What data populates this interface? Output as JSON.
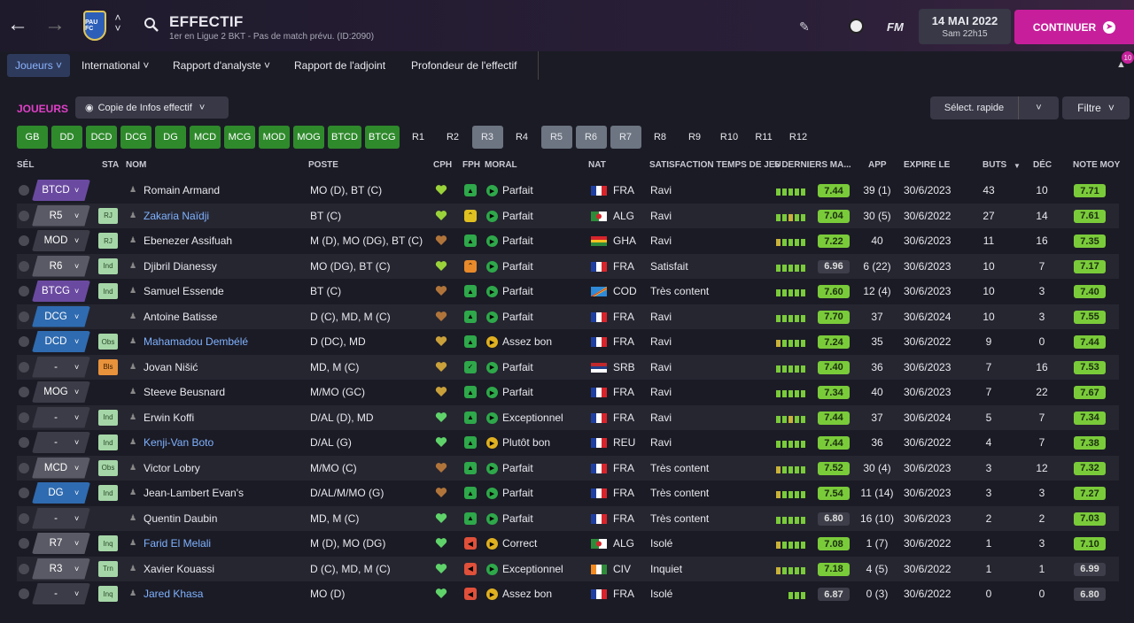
{
  "header": {
    "title": "EFFECTIF",
    "subtitle": "1er en Ligue 2 BKT - Pas de match prévu. (ID:2090)",
    "club_crest_text": "PAU FC",
    "logo_text": "FM",
    "date": "14 MAI 2022",
    "time": "Sam 22h15",
    "continue_label": "CONTINUER",
    "notifications": "10",
    "accent_color": "#c71f9b"
  },
  "menu": {
    "items": [
      {
        "label": "Joueurs",
        "active": true
      },
      {
        "label": "International",
        "active": false
      },
      {
        "label": "Rapport d'analyste",
        "active": false
      },
      {
        "label": "Rapport de l'adjoint",
        "active": false
      },
      {
        "label": "Profondeur de l'effectif",
        "active": false
      }
    ]
  },
  "toolbar": {
    "section_title": "JOUEURS",
    "copy_label": "Copie de Infos effectif",
    "quick_select_label": "Sélect. rapide",
    "filter_label": "Filtre"
  },
  "position_filters": [
    {
      "label": "GB",
      "style": "g"
    },
    {
      "label": "DD",
      "style": "g"
    },
    {
      "label": "DCD",
      "style": "g"
    },
    {
      "label": "DCG",
      "style": "g"
    },
    {
      "label": "DG",
      "style": "g"
    },
    {
      "label": "MCD",
      "style": "g"
    },
    {
      "label": "MCG",
      "style": "g"
    },
    {
      "label": "MOD",
      "style": "g"
    },
    {
      "label": "MOG",
      "style": "g"
    },
    {
      "label": "BTCD",
      "style": "g"
    },
    {
      "label": "BTCG",
      "style": "g"
    },
    {
      "label": "R1",
      "style": "k"
    },
    {
      "label": "R2",
      "style": "k"
    },
    {
      "label": "R3",
      "style": "s"
    },
    {
      "label": "R4",
      "style": "k"
    },
    {
      "label": "R5",
      "style": "s"
    },
    {
      "label": "R6",
      "style": "s"
    },
    {
      "label": "R7",
      "style": "s"
    },
    {
      "label": "R8",
      "style": "k"
    },
    {
      "label": "R9",
      "style": "k"
    },
    {
      "label": "R10",
      "style": "k"
    },
    {
      "label": "R11",
      "style": "k"
    },
    {
      "label": "R12",
      "style": "k"
    }
  ],
  "columns": {
    "sel": "SÉL",
    "sta": "STA",
    "nom": "NOM",
    "poste": "POSTE",
    "cph": "CPH",
    "fph": "FPH",
    "moral": "MORAL",
    "nat": "NAT",
    "satisfaction": "SATISFACTION TEMPS DE JEU",
    "derniers": "5 DERNIERS MA...",
    "app": "APP",
    "expire": "EXPIRE LE",
    "buts": "BUTS",
    "dec": "DÉC",
    "note": "NOTE MOY",
    "sort_icon": "▼"
  },
  "players": [
    {
      "sel": "BTCD",
      "sel_color": "#6a4aa0",
      "sta": "",
      "name": "Romain Armand",
      "link": false,
      "poste": "MO (D), BT (C)",
      "heart": "#9ad23a",
      "fph": "up",
      "moral": "Parfait",
      "mor": "#2ea84a",
      "flag": "fra",
      "nat": "FRA",
      "sat": "Ravi",
      "form": [
        "#7acb3a",
        "#7acb3a",
        "#7acb3a",
        "#7acb3a",
        "#7acb3a"
      ],
      "rating": "7.44",
      "app": "39 (1)",
      "expire": "30/6/2023",
      "buts": "43",
      "dec": "10",
      "note": "7.71"
    },
    {
      "sel": "R5",
      "sel_color": "#5a5a66",
      "sta": "RJ",
      "name": "Zakaria Naïdji",
      "link": true,
      "poste": "BT (C)",
      "heart": "#9ad23a",
      "fph": "yellow",
      "moral": "Parfait",
      "mor": "#2ea84a",
      "flag": "alg",
      "nat": "ALG",
      "sat": "Ravi",
      "form": [
        "#7acb3a",
        "#7acb3a",
        "#c9b23a",
        "#7acb3a",
        "#7acb3a"
      ],
      "rating": "7.04",
      "app": "30 (5)",
      "expire": "30/6/2022",
      "buts": "27",
      "dec": "14",
      "note": "7.61"
    },
    {
      "sel": "MOD",
      "sel_color": "#3c3c48",
      "sta": "RJ",
      "name": "Ebenezer Assifuah",
      "link": false,
      "poste": "M (D), MO (DG), BT (C)",
      "heart": "#b0743a",
      "fph": "up",
      "moral": "Parfait",
      "mor": "#2ea84a",
      "flag": "gha",
      "nat": "GHA",
      "sat": "Ravi",
      "form": [
        "#c9b23a",
        "#7acb3a",
        "#7acb3a",
        "#7acb3a",
        "#7acb3a"
      ],
      "rating": "7.22",
      "app": "40",
      "expire": "30/6/2023",
      "buts": "11",
      "dec": "16",
      "note": "7.35"
    },
    {
      "sel": "R6",
      "sel_color": "#5a5a66",
      "sta": "Ind",
      "name": "Djibril Dianessy",
      "link": false,
      "poste": "MO (DG), BT (C)",
      "heart": "#9ad23a",
      "fph": "orange",
      "moral": "Parfait",
      "mor": "#2ea84a",
      "flag": "fra",
      "nat": "FRA",
      "sat": "Satisfait",
      "form": [
        "#7acb3a",
        "#7acb3a",
        "#7acb3a",
        "#7acb3a",
        "#7acb3a"
      ],
      "rating": "6.96",
      "app": "6 (22)",
      "expire": "30/6/2023",
      "buts": "10",
      "dec": "7",
      "note": "7.17"
    },
    {
      "sel": "BTCG",
      "sel_color": "#6a4aa0",
      "sta": "Ind",
      "name": "Samuel Essende",
      "link": false,
      "poste": "BT (C)",
      "heart": "#b0743a",
      "fph": "up",
      "moral": "Parfait",
      "mor": "#2ea84a",
      "flag": "cod",
      "nat": "COD",
      "sat": "Très content",
      "form": [
        "#7acb3a",
        "#7acb3a",
        "#7acb3a",
        "#7acb3a",
        "#7acb3a"
      ],
      "rating": "7.60",
      "app": "12 (4)",
      "expire": "30/6/2023",
      "buts": "10",
      "dec": "3",
      "note": "7.40"
    },
    {
      "sel": "DCG",
      "sel_color": "#2f6bb0",
      "sta": "",
      "name": "Antoine Batisse",
      "link": false,
      "poste": "D (C), MD, M (C)",
      "heart": "#b0743a",
      "fph": "up",
      "moral": "Parfait",
      "mor": "#2ea84a",
      "flag": "fra",
      "nat": "FRA",
      "sat": "Ravi",
      "form": [
        "#7acb3a",
        "#7acb3a",
        "#7acb3a",
        "#7acb3a",
        "#7acb3a"
      ],
      "rating": "7.70",
      "app": "37",
      "expire": "30/6/2024",
      "buts": "10",
      "dec": "3",
      "note": "7.55"
    },
    {
      "sel": "DCD",
      "sel_color": "#2f6bb0",
      "sta": "Obs",
      "name": "Mahamadou Dembélé",
      "link": true,
      "poste": "D (DC), MD",
      "heart": "#c9a03a",
      "fph": "up",
      "moral": "Assez bon",
      "mor": "#e0b020",
      "flag": "fra",
      "nat": "FRA",
      "sat": "Ravi",
      "form": [
        "#c9b23a",
        "#7acb3a",
        "#7acb3a",
        "#7acb3a",
        "#7acb3a"
      ],
      "rating": "7.24",
      "app": "35",
      "expire": "30/6/2022",
      "buts": "9",
      "dec": "0",
      "note": "7.44"
    },
    {
      "sel": "-",
      "sel_color": "#3c3c48",
      "sta": "Bls",
      "name": "Jovan Nišić",
      "link": false,
      "poste": "MD, M (C)",
      "heart": "#c9a03a",
      "fph": "check",
      "moral": "Parfait",
      "mor": "#2ea84a",
      "flag": "srb",
      "nat": "SRB",
      "sat": "Ravi",
      "form": [
        "#7acb3a",
        "#7acb3a",
        "#7acb3a",
        "#7acb3a",
        "#7acb3a"
      ],
      "rating": "7.40",
      "app": "36",
      "expire": "30/6/2023",
      "buts": "7",
      "dec": "16",
      "note": "7.53"
    },
    {
      "sel": "MOG",
      "sel_color": "#3c3c48",
      "sta": "",
      "name": "Steeve Beusnard",
      "link": false,
      "poste": "M/MO (GC)",
      "heart": "#c9a03a",
      "fph": "up",
      "moral": "Parfait",
      "mor": "#2ea84a",
      "flag": "fra",
      "nat": "FRA",
      "sat": "Ravi",
      "form": [
        "#7acb3a",
        "#7acb3a",
        "#7acb3a",
        "#7acb3a",
        "#7acb3a"
      ],
      "rating": "7.34",
      "app": "40",
      "expire": "30/6/2023",
      "buts": "7",
      "dec": "22",
      "note": "7.67"
    },
    {
      "sel": "-",
      "sel_color": "#3c3c48",
      "sta": "Ind",
      "name": "Erwin Koffi",
      "link": false,
      "poste": "D/AL (D), MD",
      "heart": "#5fd36a",
      "fph": "up",
      "moral": "Exceptionnel",
      "mor": "#2ea84a",
      "flag": "fra",
      "nat": "FRA",
      "sat": "Ravi",
      "form": [
        "#7acb3a",
        "#7acb3a",
        "#c9b23a",
        "#7acb3a",
        "#7acb3a"
      ],
      "rating": "7.44",
      "app": "37",
      "expire": "30/6/2024",
      "buts": "5",
      "dec": "7",
      "note": "7.34"
    },
    {
      "sel": "-",
      "sel_color": "#3c3c48",
      "sta": "Ind",
      "name": "Kenji-Van Boto",
      "link": true,
      "poste": "D/AL (G)",
      "heart": "#5fd36a",
      "fph": "up",
      "moral": "Plutôt bon",
      "mor": "#e0b020",
      "flag": "fra",
      "nat": "REU",
      "sat": "Ravi",
      "form": [
        "#7acb3a",
        "#7acb3a",
        "#7acb3a",
        "#7acb3a",
        "#7acb3a"
      ],
      "rating": "7.44",
      "app": "36",
      "expire": "30/6/2022",
      "buts": "4",
      "dec": "7",
      "note": "7.38"
    },
    {
      "sel": "MCD",
      "sel_color": "#5a5a66",
      "sta": "Obs",
      "name": "Victor Lobry",
      "link": false,
      "poste": "M/MO (C)",
      "heart": "#b0743a",
      "fph": "up",
      "moral": "Parfait",
      "mor": "#2ea84a",
      "flag": "fra",
      "nat": "FRA",
      "sat": "Très content",
      "form": [
        "#c9b23a",
        "#7acb3a",
        "#7acb3a",
        "#7acb3a",
        "#7acb3a"
      ],
      "rating": "7.52",
      "app": "30 (4)",
      "expire": "30/6/2023",
      "buts": "3",
      "dec": "12",
      "note": "7.32"
    },
    {
      "sel": "DG",
      "sel_color": "#2f6bb0",
      "sta": "Ind",
      "name": "Jean-Lambert Evan's",
      "link": false,
      "poste": "D/AL/M/MO (G)",
      "heart": "#b0743a",
      "fph": "up",
      "moral": "Parfait",
      "mor": "#2ea84a",
      "flag": "fra",
      "nat": "FRA",
      "sat": "Très content",
      "form": [
        "#c9b23a",
        "#7acb3a",
        "#7acb3a",
        "#7acb3a",
        "#7acb3a"
      ],
      "rating": "7.54",
      "app": "11 (14)",
      "expire": "30/6/2023",
      "buts": "3",
      "dec": "3",
      "note": "7.27"
    },
    {
      "sel": "-",
      "sel_color": "#3c3c48",
      "sta": "",
      "name": "Quentin Daubin",
      "link": false,
      "poste": "MD, M (C)",
      "heart": "#5fd36a",
      "fph": "up",
      "moral": "Parfait",
      "mor": "#2ea84a",
      "flag": "fra",
      "nat": "FRA",
      "sat": "Très content",
      "form": [
        "#7acb3a",
        "#7acb3a",
        "#7acb3a",
        "#7acb3a",
        "#7acb3a"
      ],
      "rating": "6.80",
      "app": "16 (10)",
      "expire": "30/6/2023",
      "buts": "2",
      "dec": "2",
      "note": "7.03"
    },
    {
      "sel": "R7",
      "sel_color": "#5a5a66",
      "sta": "Inq",
      "name": "Farid El Melali",
      "link": true,
      "poste": "M (D), MO (DG)",
      "heart": "#5fd36a",
      "fph": "red",
      "moral": "Correct",
      "mor": "#e0b020",
      "flag": "alg",
      "nat": "ALG",
      "sat": "Isolé",
      "form": [
        "#c9b23a",
        "#7acb3a",
        "#7acb3a",
        "#7acb3a",
        "#7acb3a"
      ],
      "rating": "7.08",
      "app": "1 (7)",
      "expire": "30/6/2022",
      "buts": "1",
      "dec": "3",
      "note": "7.10"
    },
    {
      "sel": "R3",
      "sel_color": "#5a5a66",
      "sta": "Trn",
      "name": "Xavier Kouassi",
      "link": false,
      "poste": "D (C), MD, M (C)",
      "heart": "#5fd36a",
      "fph": "red",
      "moral": "Exceptionnel",
      "mor": "#2ea84a",
      "flag": "civ",
      "nat": "CIV",
      "sat": "Inquiet",
      "form": [
        "#c9b23a",
        "#7acb3a",
        "#7acb3a",
        "#7acb3a",
        "#7acb3a"
      ],
      "rating": "7.18",
      "app": "4 (5)",
      "expire": "30/6/2022",
      "buts": "1",
      "dec": "1",
      "note": "6.99"
    },
    {
      "sel": "-",
      "sel_color": "#3c3c48",
      "sta": "Inq",
      "name": "Jared Khasa",
      "link": true,
      "poste": "MO (D)",
      "heart": "#5fd36a",
      "fph": "red",
      "moral": "Assez bon",
      "mor": "#e0b020",
      "flag": "fra",
      "nat": "FRA",
      "sat": "Isolé",
      "form": [
        "#7acb3a",
        "#7acb3a",
        "#7acb3a"
      ],
      "rating": "6.87",
      "app": "0 (3)",
      "expire": "30/6/2022",
      "buts": "0",
      "dec": "0",
      "note": "6.80"
    }
  ]
}
